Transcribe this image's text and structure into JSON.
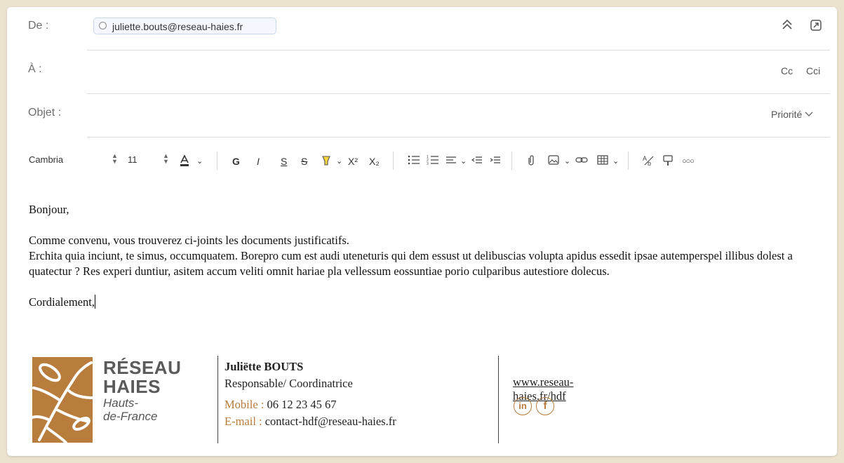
{
  "header": {
    "from_label": "De :",
    "from_value": "juliette.bouts@reseau-haies.fr",
    "to_label": "À :",
    "cc_label": "Cc",
    "bcc_label": "Cci",
    "subject_label": "Objet :",
    "priority_label": "Priorité"
  },
  "toolbar": {
    "font_name": "Cambria",
    "font_size": "11",
    "bold_label": "G",
    "italic_label": "I",
    "underline_label": "S",
    "strike_label": "S",
    "superscript_label": "X²",
    "subscript_label": "X₂"
  },
  "body": {
    "greeting": "Bonjour,",
    "line1": "Comme convenu, vous trouverez ci-joints les documents justificatifs.",
    "line2": "Erchita quia inciunt, te simus, occumquatem. Borepro cum est audi uteneturis qui dem essust ut delibuscias volupta apidus essedit ipsae autemperspel illibus dolest a quatectur ? Res experi duntiur, asitem accum veliti omnit hariae pla vellessum eossuntiae porio culparibus autestiore dolecus.",
    "closing": "Cordialement,"
  },
  "signature": {
    "logo_line1": "RÉSEAU",
    "logo_line2": "HAIES",
    "logo_line3": "Hauts-",
    "logo_line4": "de-France",
    "name": "Juliëtte BOUTS",
    "role": "Responsable/ Coordinatrice",
    "mobile_label": "Mobile : ",
    "mobile_value": "06 12 23 45 67",
    "email_label": "E-mail : ",
    "email_value": "contact-hdf@reseau-haies.fr",
    "website": "www.reseau-haies.fr/hdf",
    "linkedin": "in",
    "facebook": "f"
  },
  "colors": {
    "accent": "#b87c3c",
    "page_bg": "#ece3cf"
  }
}
